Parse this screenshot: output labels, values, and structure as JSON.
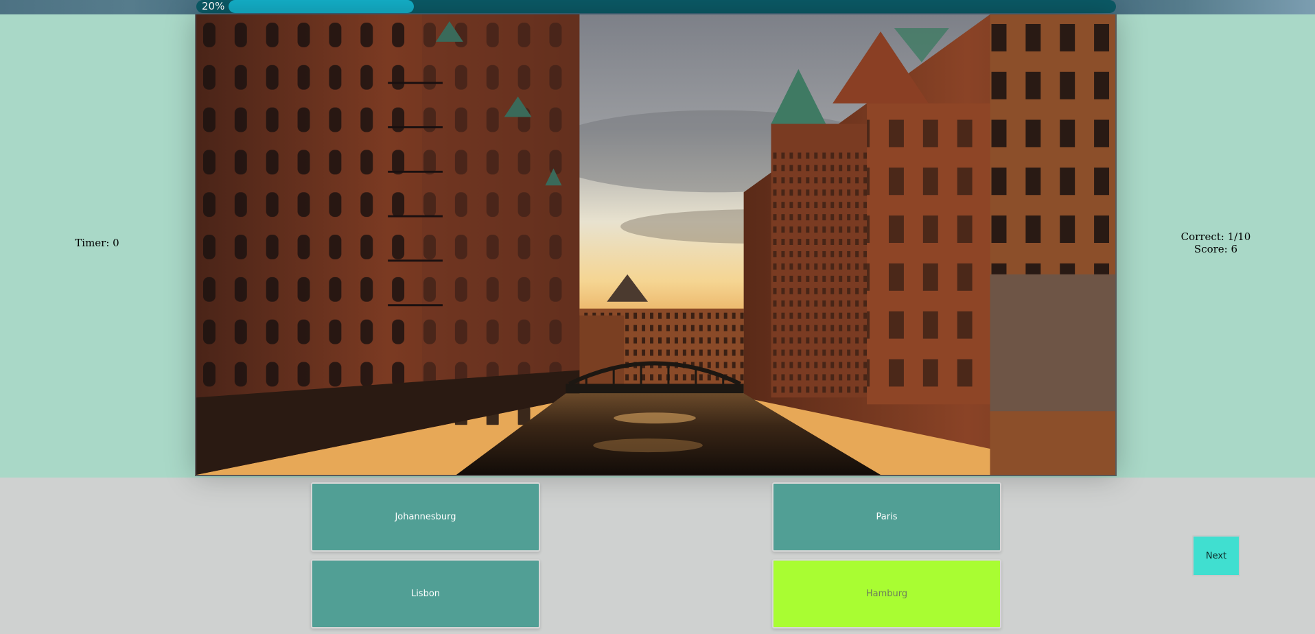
{
  "progress": {
    "label": "20%",
    "value": 0.2
  },
  "timer": {
    "label": "Timer: 0"
  },
  "stats": {
    "correct": "Correct: 1/10",
    "score": "Score: 6"
  },
  "photo": {
    "subject": "canal between red-brick warehouse buildings at sunset with a bridge"
  },
  "answers": [
    {
      "label": "Johannesburg",
      "state": "default"
    },
    {
      "label": "Paris",
      "state": "default"
    },
    {
      "label": "Lisbon",
      "state": "default"
    },
    {
      "label": "Hamburg",
      "state": "correct"
    }
  ],
  "next": {
    "label": "Next"
  },
  "colors": {
    "stage_bg": "#a9d8c7",
    "page_bg": "#cfd1d0",
    "answer_bg": "#519f95",
    "correct_bg": "#a9fd32",
    "next_bg": "#40dfd0",
    "progress_fill": "#14b0c9",
    "progress_track": "#0b5a66"
  }
}
